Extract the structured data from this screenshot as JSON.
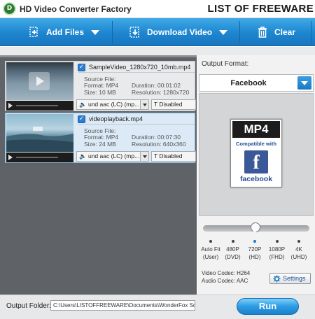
{
  "app": {
    "title": "HD Video Converter Factory",
    "logo_text": "D",
    "watermark": "LIST OF FREEWARE"
  },
  "toolbar": {
    "add_files_label": "Add Files",
    "download_video_label": "Download Video",
    "clear_label": "Clear"
  },
  "files": [
    {
      "name": "SampleVideo_1280x720_10mb.mp4",
      "source_label": "Source File:",
      "format": "Format: MP4",
      "duration": "Duration: 00:01:02",
      "size": "Size: 10 MB",
      "resolution": "Resolution: 1280x720",
      "audio": "und aac (LC) (mp...",
      "subtitle": "Disabled",
      "checked": true
    },
    {
      "name": "videoplayback.mp4",
      "source_label": "Source File:",
      "format": "Format: MP4",
      "duration": "Duration: 00:07:30",
      "size": "Size: 24 MB",
      "resolution": "Resolution: 640x360",
      "audio": "und aac (LC) (mp...",
      "subtitle": "Disabled",
      "checked": true
    }
  ],
  "output": {
    "label": "Output Format:",
    "selected_format": "Facebook",
    "card_title": "MP4",
    "card_compat": "Compatible with",
    "card_icon_letter": "f",
    "card_brand": "facebook",
    "quality_options": [
      {
        "label": "Auto Fit",
        "sub": "(User)"
      },
      {
        "label": "480P",
        "sub": "(DVD)"
      },
      {
        "label": "720P",
        "sub": "(HD)"
      },
      {
        "label": "1080P",
        "sub": "(FHD)"
      },
      {
        "label": "4K",
        "sub": "(UHD)"
      }
    ],
    "quality_selected_index": 2,
    "video_codec": "Video Codec: H264",
    "audio_codec": "Audio Codec: AAC",
    "settings_label": "Settings"
  },
  "bottom": {
    "folder_label": "Output Folder:",
    "folder_value": "C:\\Users\\LISTOFFREEWARE\\Documents\\WonderFox Soft\\",
    "run_label": "Run"
  },
  "colors": {
    "toolbar": "#1e85cf",
    "accent": "#1a78c4",
    "facebook": "#3b5998"
  }
}
